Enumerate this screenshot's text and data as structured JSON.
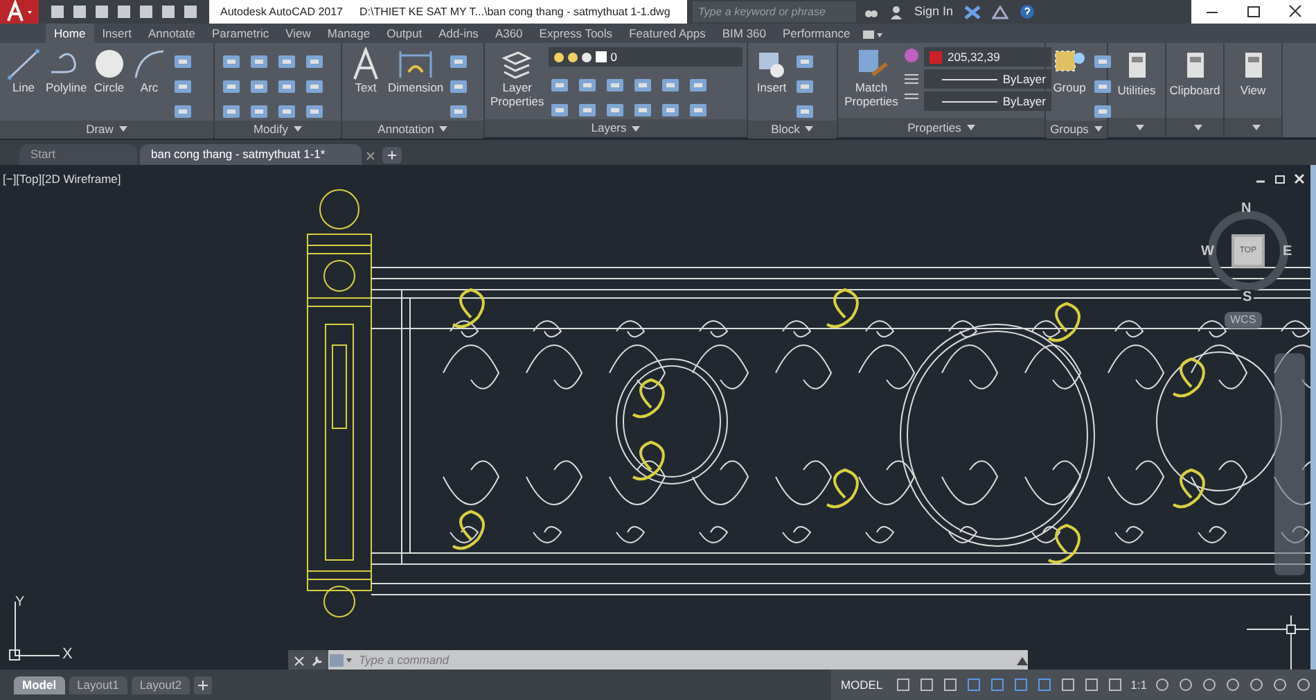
{
  "title_bar": {
    "app_title": "Autodesk AutoCAD 2017",
    "file_path": "D:\\THIET KE SAT MY T...\\ban cong thang - satmythuat 1-1.dwg",
    "search": {
      "placeholder": "Type a keyword or phrase"
    },
    "sign_in": "Sign In"
  },
  "ribbon_tabs": [
    {
      "label": "Home",
      "selected": true
    },
    {
      "label": "Insert",
      "selected": false
    },
    {
      "label": "Annotate",
      "selected": false
    },
    {
      "label": "Parametric",
      "selected": false
    },
    {
      "label": "View",
      "selected": false
    },
    {
      "label": "Manage",
      "selected": false
    },
    {
      "label": "Output",
      "selected": false
    },
    {
      "label": "Add-ins",
      "selected": false
    },
    {
      "label": "A360",
      "selected": false
    },
    {
      "label": "Express Tools",
      "selected": false
    },
    {
      "label": "Featured Apps",
      "selected": false
    },
    {
      "label": "BIM 360",
      "selected": false
    },
    {
      "label": "Performance",
      "selected": false
    }
  ],
  "panels": {
    "draw": {
      "title": "Draw",
      "tools": [
        "Line",
        "Polyline",
        "Circle",
        "Arc"
      ]
    },
    "modify": {
      "title": "Modify"
    },
    "annotation": {
      "title": "Annotation",
      "tools": [
        "Text",
        "Dimension"
      ]
    },
    "layers": {
      "title": "Layers",
      "tool": "Layer Properties",
      "current_layer": "0"
    },
    "block": {
      "title": "Block",
      "tool": "Insert"
    },
    "properties": {
      "title": "Properties",
      "tool": "Match Properties",
      "color_value": "205,32,39",
      "linetype": "ByLayer",
      "lineweight": "ByLayer"
    },
    "groups": {
      "title": "Groups",
      "tool": "Group"
    },
    "utilities": {
      "title": "Utilities"
    },
    "clipboard": {
      "title": "Clipboard"
    },
    "view": {
      "title": "View"
    }
  },
  "document_tabs": [
    {
      "label": "Start",
      "selected": false
    },
    {
      "label": "ban cong thang - satmythuat 1-1*",
      "selected": true
    }
  ],
  "viewport": {
    "label": "[−][Top][2D Wireframe]",
    "viewcube": {
      "north": "N",
      "south": "S",
      "east": "E",
      "west": "W",
      "face": "TOP",
      "coordinate_system": "WCS"
    },
    "ucs": {
      "y": "Y",
      "x": "X"
    }
  },
  "command_line": {
    "placeholder": "Type a command"
  },
  "layout_tabs": [
    {
      "label": "Model",
      "selected": true
    },
    {
      "label": "Layout1",
      "selected": false
    },
    {
      "label": "Layout2",
      "selected": false
    }
  ],
  "status_bar": {
    "mode": "MODEL",
    "scale": "1:1"
  }
}
